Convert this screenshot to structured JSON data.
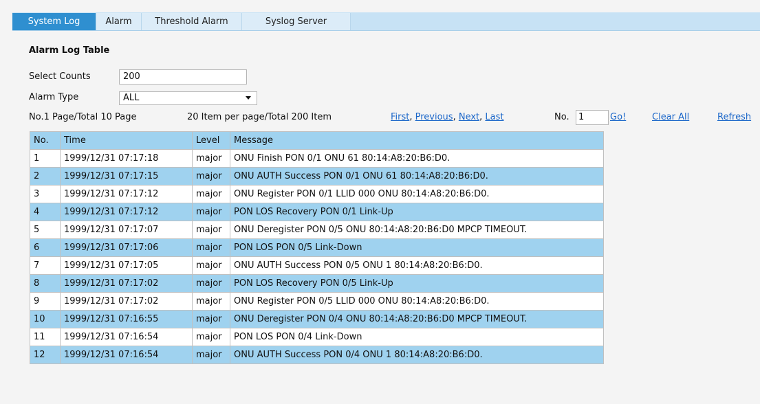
{
  "tabs": [
    {
      "label": "System Log",
      "active": true
    },
    {
      "label": "Alarm",
      "active": false
    },
    {
      "label": "Threshold Alarm",
      "active": false
    },
    {
      "label": "Syslog Server",
      "active": false
    }
  ],
  "title": "Alarm Log Table",
  "form": {
    "select_counts_label": "Select Counts",
    "select_counts_value": "200",
    "alarm_type_label": "Alarm Type",
    "alarm_type_value": "ALL"
  },
  "pager": {
    "page_info": "No.1 Page/Total 10 Page",
    "item_info": "20 Item per page/Total 200 Item",
    "first": "First",
    "previous": "Previous",
    "next": "Next",
    "last": "Last",
    "no_label": "No.",
    "page_input": "1",
    "go": "Go!",
    "clear_all": "Clear All",
    "refresh": "Refresh"
  },
  "table": {
    "headers": [
      "No.",
      "Time",
      "Level",
      "Message"
    ],
    "rows": [
      [
        "1",
        "1999/12/31 07:17:18",
        "major",
        "ONU Finish PON 0/1 ONU 61 80:14:A8:20:B6:D0."
      ],
      [
        "2",
        "1999/12/31 07:17:15",
        "major",
        "ONU AUTH Success PON 0/1 ONU 61 80:14:A8:20:B6:D0."
      ],
      [
        "3",
        "1999/12/31 07:17:12",
        "major",
        "ONU Register PON 0/1 LLID 000 ONU 80:14:A8:20:B6:D0."
      ],
      [
        "4",
        "1999/12/31 07:17:12",
        "major",
        "PON LOS Recovery PON 0/1 Link-Up"
      ],
      [
        "5",
        "1999/12/31 07:17:07",
        "major",
        "ONU Deregister PON 0/5 ONU 80:14:A8:20:B6:D0 MPCP TIMEOUT."
      ],
      [
        "6",
        "1999/12/31 07:17:06",
        "major",
        "PON LOS PON 0/5 Link-Down"
      ],
      [
        "7",
        "1999/12/31 07:17:05",
        "major",
        "ONU AUTH Success PON 0/5 ONU 1 80:14:A8:20:B6:D0."
      ],
      [
        "8",
        "1999/12/31 07:17:02",
        "major",
        "PON LOS Recovery PON 0/5 Link-Up"
      ],
      [
        "9",
        "1999/12/31 07:17:02",
        "major",
        "ONU Register PON 0/5 LLID 000 ONU 80:14:A8:20:B6:D0."
      ],
      [
        "10",
        "1999/12/31 07:16:55",
        "major",
        "ONU Deregister PON 0/4 ONU 80:14:A8:20:B6:D0 MPCP TIMEOUT."
      ],
      [
        "11",
        "1999/12/31 07:16:54",
        "major",
        "PON LOS PON 0/4 Link-Down"
      ],
      [
        "12",
        "1999/12/31 07:16:54",
        "major",
        "ONU AUTH Success PON 0/4 ONU 1 80:14:A8:20:B6:D0."
      ]
    ]
  },
  "colors": {
    "accent": "#2f8fd0",
    "row_highlight": "#9fd2ef",
    "link": "#1a66c9"
  }
}
